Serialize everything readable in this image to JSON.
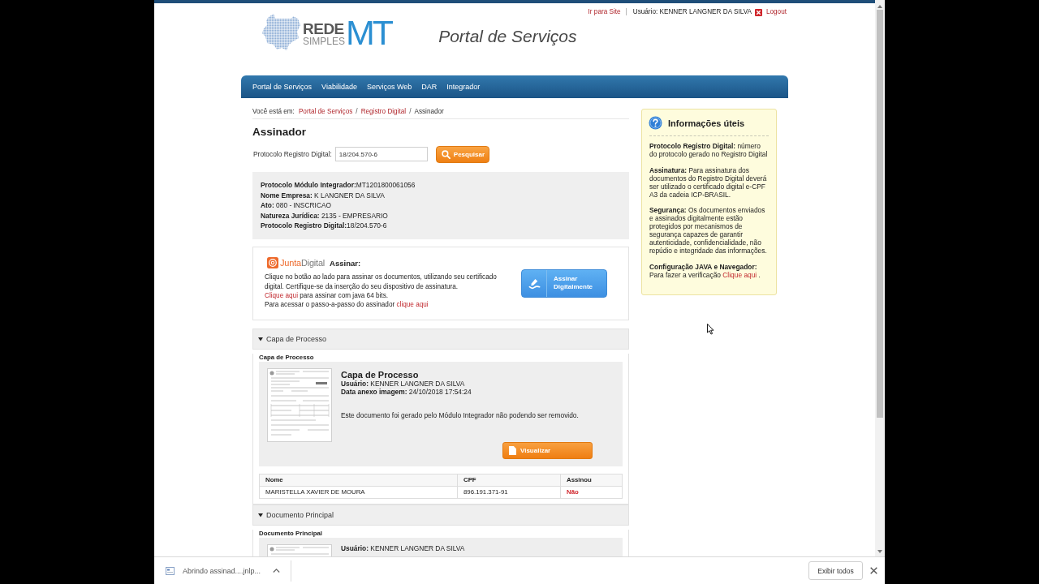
{
  "header": {
    "logo": {
      "word1": "REDE",
      "word2": "SIMPLES",
      "mark": "MT"
    },
    "title": "Portal de Serviços",
    "site_link": "Ir para Site",
    "separator": "|",
    "user": "Usuário: KENNER LANGNER DA SILVA",
    "logout": "Logout"
  },
  "nav": [
    "Portal de Serviços",
    "Viabilidade",
    "Serviços Web",
    "DAR",
    "Integrador"
  ],
  "breadcrumb": {
    "prefix": "Você está em:",
    "items": [
      {
        "label": "Portal de Serviços",
        "current": false
      },
      {
        "separator": "/",
        "label": "Registro Digital",
        "current": false
      },
      {
        "separator": "/",
        "label": "Assinador",
        "current": true
      }
    ]
  },
  "page_title": "Assinador",
  "search": {
    "label": "Protocolo Registro Digital:",
    "value": "18/204.570-6",
    "button": "Pesquisar"
  },
  "summary": [
    "**Protocolo Módulo Integrador:**MT1201800061056",
    "**Nome Empresa:** K LANGNER DA SILVA",
    "**Ato:** 080 - INSCRICAO",
    "**Natureza Jurídica:** 2135 - EMPRESARIO",
    "**Protocolo Registro Digital:**18/204.570-6"
  ],
  "signing": {
    "brand": {
      "part1": "Junta",
      "part2": "Digital"
    },
    "heading": "Assinar:",
    "paragraphs": [
      {
        "parts": [
          {
            "kind": "text",
            "text": "Clique no botão ao lado para assinar os documentos, utilizando seu certificado digital. Certifique-se da inserção do seu dispositivo de assinatura."
          }
        ]
      },
      {
        "parts": [
          {
            "kind": "link",
            "text": "Clique aqui"
          },
          {
            "kind": "text",
            "text": " para assinar com java 64 bits."
          }
        ]
      },
      {
        "parts": [
          {
            "kind": "text",
            "text": "Para acessar o passo-a-passo do assinador "
          },
          {
            "kind": "link",
            "text": "clique aqui"
          }
        ]
      }
    ],
    "button": "Assinar Digitalmente"
  },
  "sections": [
    {
      "title": "Capa de Processo",
      "expanded": true,
      "subtitle": "Capa de Processo",
      "document": {
        "title": "Capa de Processo",
        "details": [
          "**Usuário:** KENNER LANGNER DA SILVA",
          "**Data anexo imagem:** 24/10/2018 17:54:24"
        ],
        "note": "Este documento foi gerado pelo Módulo Integrador não podendo ser removido.",
        "button": "Visualizar"
      },
      "table": {
        "columns": [
          "Nome",
          "CPF",
          "Assinou"
        ],
        "rows": [
          {
            "cells": [
              "MARISTELLA XAVIER DE MOURA",
              "896.191.371-91",
              "Não"
            ],
            "signed": false
          }
        ]
      }
    },
    {
      "title": "Documento Principal",
      "expanded": true,
      "subtitle": "Documento Principal",
      "document": {
        "details": [
          "**Usuário:** KENNER LANGNER DA SILVA"
        ]
      }
    }
  ],
  "info": {
    "title": "Informações úteis",
    "items": [
      {
        "parts": [
          {
            "kind": "text",
            "text": "**Protocolo Registro Digital:** número do protocolo gerado no Registro Digital"
          }
        ]
      },
      {
        "parts": [
          {
            "kind": "text",
            "text": "**Assinatura:** Para assinatura dos documentos do Registro Digital deverá ser utilizado o certificado digital e-CPF A3 da cadeia ICP-BRASIL."
          }
        ]
      },
      {
        "parts": [
          {
            "kind": "text",
            "text": "**Segurança:** Os documentos enviados e assinados digitalmente estão protegidos por mecanismos de segurança capazes de garantir autenticidade, confidencialidade, não repúdio e integridade das informações."
          }
        ]
      },
      {
        "parts": [
          {
            "kind": "text",
            "text": "**Configuração JAVA e Navegador:** Para fazer a verificação "
          },
          {
            "kind": "link",
            "text": "Clique aqui"
          },
          {
            "kind": "text",
            "text": " ."
          }
        ]
      }
    ]
  },
  "download": {
    "file": "Abrindo assinad....jnlp...",
    "show_all": "Exibir todos"
  }
}
